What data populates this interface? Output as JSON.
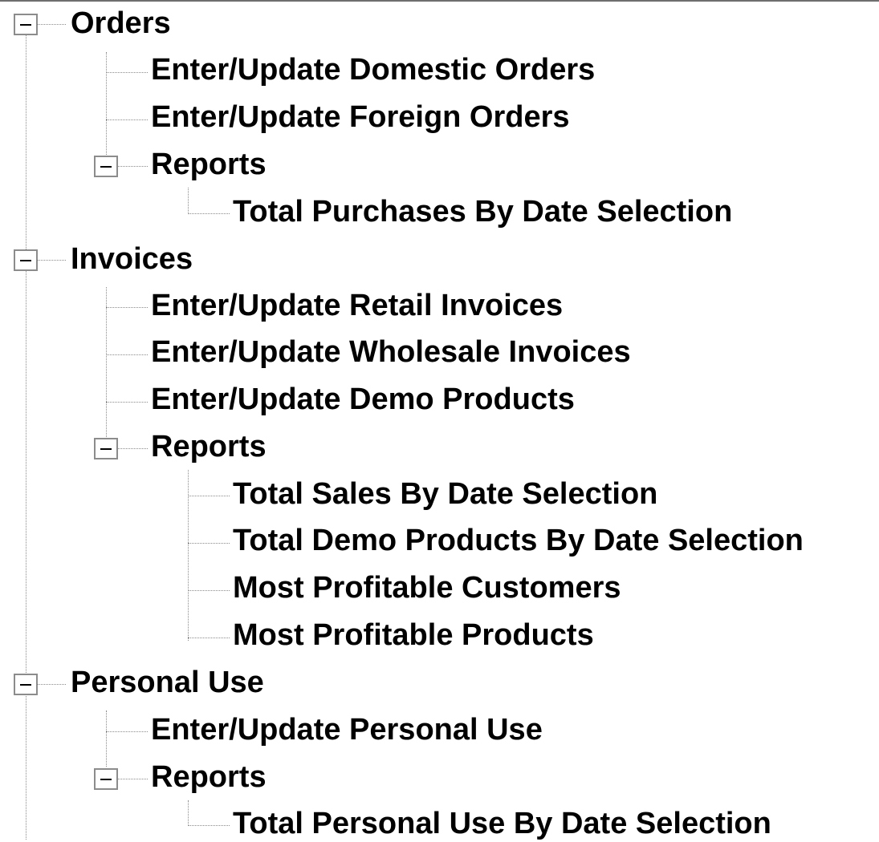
{
  "tree": {
    "nodes": [
      {
        "label": "Orders",
        "icon": "minus-expander-icon",
        "expanded": true,
        "children": [
          {
            "label": "Enter/Update Domestic Orders"
          },
          {
            "label": "Enter/Update Foreign Orders"
          },
          {
            "label": "Reports",
            "icon": "minus-expander-icon",
            "expanded": true,
            "children": [
              {
                "label": "Total Purchases By Date Selection"
              }
            ]
          }
        ]
      },
      {
        "label": "Invoices",
        "icon": "minus-expander-icon",
        "expanded": true,
        "children": [
          {
            "label": "Enter/Update Retail Invoices"
          },
          {
            "label": "Enter/Update Wholesale Invoices"
          },
          {
            "label": "Enter/Update Demo Products"
          },
          {
            "label": "Reports",
            "icon": "minus-expander-icon",
            "expanded": true,
            "children": [
              {
                "label": "Total Sales By Date Selection"
              },
              {
                "label": "Total Demo Products By Date Selection"
              },
              {
                "label": "Most Profitable Customers"
              },
              {
                "label": "Most Profitable Products"
              }
            ]
          }
        ]
      },
      {
        "label": "Personal Use",
        "icon": "minus-expander-icon",
        "expanded": true,
        "children": [
          {
            "label": "Enter/Update Personal Use"
          },
          {
            "label": "Reports",
            "icon": "minus-expander-icon",
            "expanded": true,
            "children": [
              {
                "label": "Total Personal Use By Date Selection"
              }
            ]
          }
        ]
      }
    ]
  }
}
